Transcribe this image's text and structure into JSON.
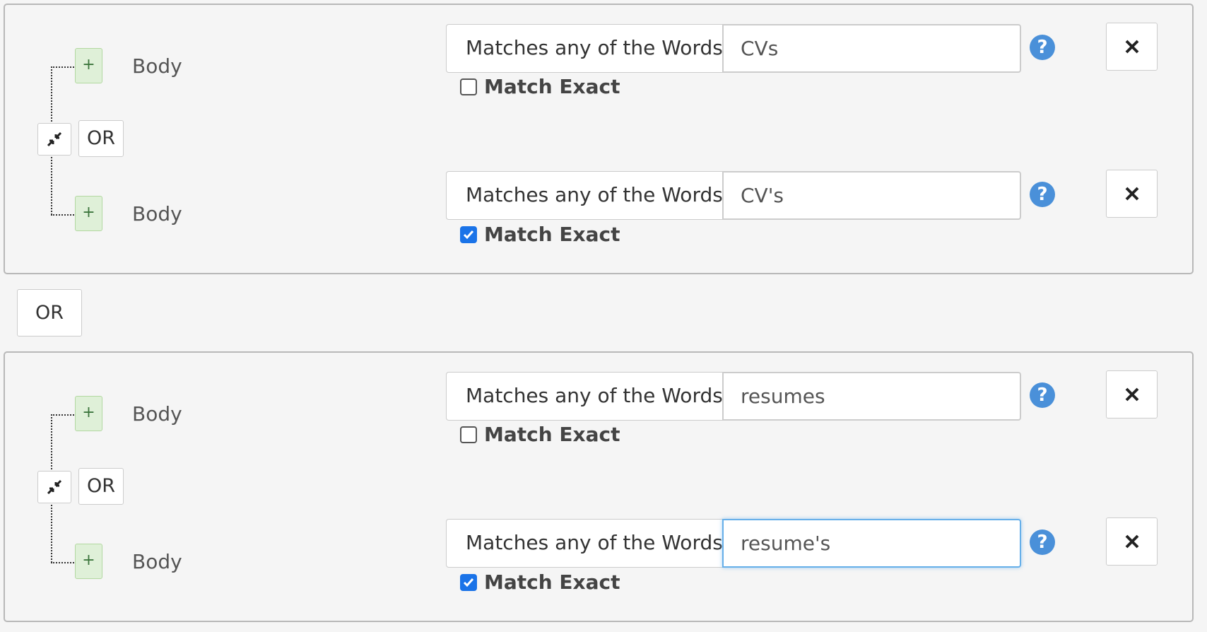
{
  "groups": [
    {
      "operator": "OR",
      "rows": [
        {
          "field": "Body",
          "plus": "+",
          "condition_type": "Matches any of the Words",
          "value": "CVs",
          "match_exact_label": "Match Exact",
          "match_exact": false
        },
        {
          "field": "Body",
          "plus": "+",
          "condition_type": "Matches any of the Words",
          "value": "CV's",
          "match_exact_label": "Match Exact",
          "match_exact": true
        }
      ]
    },
    {
      "operator": "OR",
      "rows": [
        {
          "field": "Body",
          "plus": "+",
          "condition_type": "Matches any of the Words",
          "value": "resumes",
          "match_exact_label": "Match Exact",
          "match_exact": false
        },
        {
          "field": "Body",
          "plus": "+",
          "condition_type": "Matches any of the Words",
          "value": "resume's",
          "match_exact_label": "Match Exact",
          "match_exact": true,
          "focused": true
        }
      ]
    }
  ],
  "between_groups_operator": "OR",
  "help_glyph": "?",
  "icons": {
    "collapse": "compress-arrows-icon",
    "remove": "close-icon",
    "help": "question-circle-icon",
    "check": "check-icon"
  },
  "colors": {
    "accent": "#4a90d9",
    "plus_bg": "#dff0d8",
    "checkbox_checked": "#1a73e8",
    "focus_border": "#66afe9"
  }
}
